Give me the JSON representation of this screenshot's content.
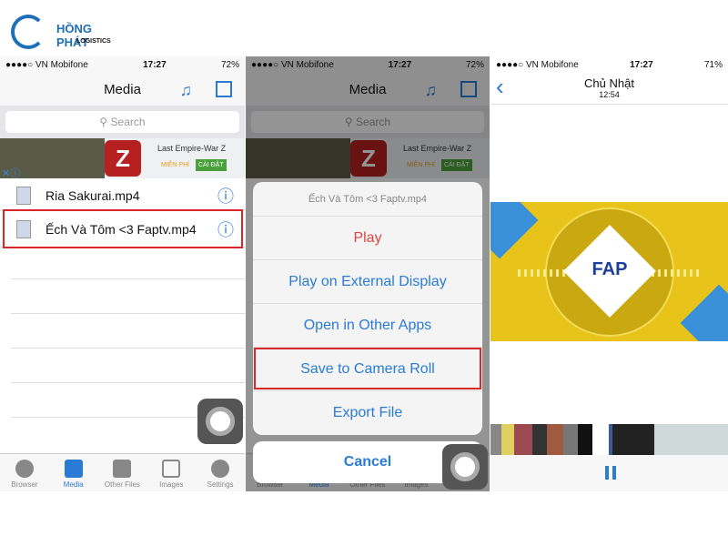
{
  "logo": {
    "text": "HỒNG PHÁT",
    "sub": "LOGISTICS"
  },
  "panel1": {
    "status": {
      "carrier": "●●●●○ VN Mobifone",
      "time": "17:27",
      "battery": "72%"
    },
    "title": "Media",
    "search_placeholder": "Search",
    "ad": {
      "title": "Last Empire-War Z",
      "free": "MIỄN PHÍ",
      "install": "CÀI ĐẶT"
    },
    "files": [
      "Ria Sakurai.mp4",
      "Ếch Và Tôm <3 Faptv.mp4"
    ],
    "tabs": [
      "Browser",
      "Media",
      "Other Files",
      "Images",
      "Settings"
    ]
  },
  "panel2": {
    "status": {
      "carrier": "●●●●○ VN Mobifone",
      "time": "17:27",
      "battery": "72%"
    },
    "title": "Media",
    "search_placeholder": "Search",
    "ad": {
      "title": "Last Empire-War Z",
      "free": "MIỄN PHÍ",
      "install": "CÀI ĐẶT"
    },
    "sheet_title": "Ếch Và Tôm <3 Faptv.mp4",
    "actions": [
      "Play",
      "Play on External Display",
      "Open in Other Apps",
      "Save to Camera Roll",
      "Export File"
    ],
    "cancel": "Cancel",
    "tabs": [
      "Browser",
      "Media",
      "Other Files",
      "Images"
    ]
  },
  "panel3": {
    "status": {
      "carrier": "●●●●○ VN Mobifone",
      "time": "17:27",
      "battery": "71%"
    },
    "title": "Chủ Nhật",
    "subtitle": "12:54",
    "video_logo": "FAP"
  },
  "colors": {
    "accent": "#2a7bd6",
    "destructive": "#e0453f",
    "highlight": "#d9262b",
    "video_yellow": "#e8c31a"
  }
}
